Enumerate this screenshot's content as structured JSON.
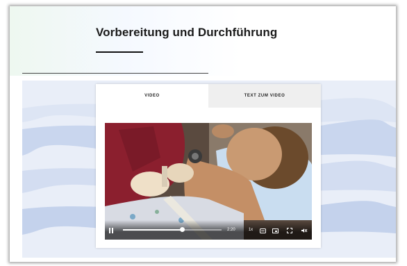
{
  "section": {
    "title": "Vorbereitung und Durchführung"
  },
  "tabs": [
    {
      "label": "VIDEO",
      "active": true
    },
    {
      "label": "TEXT ZUM VIDEO",
      "active": false
    }
  ],
  "player": {
    "progress_fraction": 0.6,
    "time": "2:20",
    "speed": "1x",
    "icons": [
      "pause-icon",
      "captions-icon",
      "picture-in-picture-icon",
      "fullscreen-icon",
      "mute-icon"
    ]
  },
  "colors": {
    "band": "#e9eef8",
    "wave": "#c9d6ee",
    "inactive_tab": "#efefef"
  }
}
